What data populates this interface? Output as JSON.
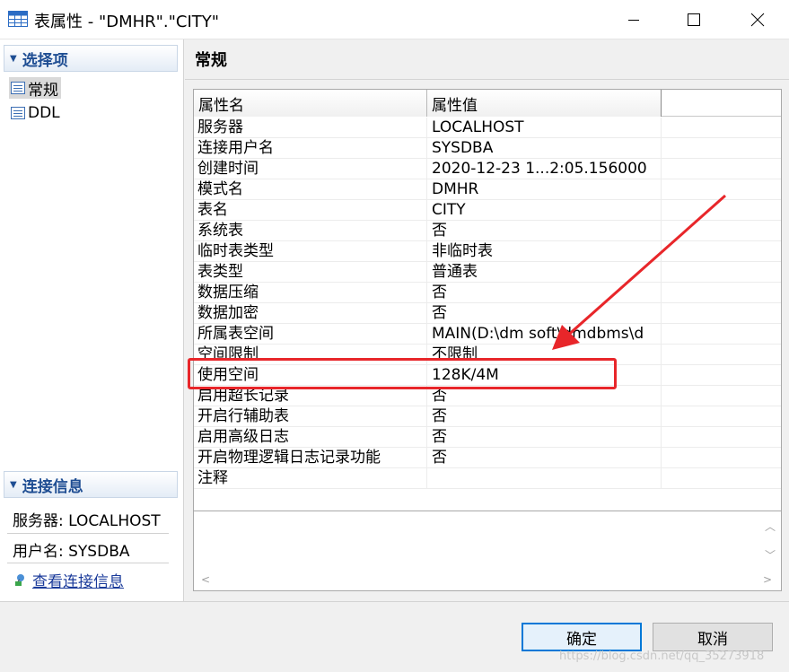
{
  "window": {
    "title": "表属性 - \"DMHR\".\"CITY\"",
    "icon": "table-icon",
    "controls": [
      "minimize-icon",
      "maximize-icon",
      "close-icon"
    ]
  },
  "left_panel": {
    "options_header": "选择项",
    "nav_items": [
      {
        "label": "常规",
        "icon": "list-icon",
        "selected": true
      },
      {
        "label": "DDL",
        "icon": "list-icon",
        "selected": false
      }
    ],
    "connection_header": "连接信息",
    "server_line": "服务器: LOCALHOST",
    "user_line": "用户名: SYSDBA",
    "view_connection_link": "查看连接信息"
  },
  "main": {
    "page_title": "常规",
    "table": {
      "columns": [
        "属性名",
        "属性值"
      ],
      "rows": [
        [
          "服务器",
          "LOCALHOST"
        ],
        [
          "连接用户名",
          "SYSDBA"
        ],
        [
          "创建时间",
          "2020-12-23 1...2:05.156000"
        ],
        [
          "模式名",
          "DMHR"
        ],
        [
          "表名",
          "CITY"
        ],
        [
          "系统表",
          "否"
        ],
        [
          "临时表类型",
          "非临时表"
        ],
        [
          "表类型",
          "普通表"
        ],
        [
          "数据压缩",
          "否"
        ],
        [
          "数据加密",
          "否"
        ],
        [
          "所属表空间",
          "MAIN(D:\\dm soft\\dmdbms\\d"
        ],
        [
          "空间限制",
          "不限制"
        ],
        [
          "使用空间",
          "128K/4M"
        ],
        [
          "启用超长记录",
          "否"
        ],
        [
          "开启行辅助表",
          "否"
        ],
        [
          "启用高级日志",
          "否"
        ],
        [
          "开启物理逻辑日志记录功能",
          "否"
        ],
        [
          "注释",
          ""
        ]
      ]
    },
    "annotation_color": "#e8262a"
  },
  "buttons": {
    "ok": "确定",
    "cancel": "取消"
  },
  "watermark": "https://blog.csdn.net/qq_35273918"
}
